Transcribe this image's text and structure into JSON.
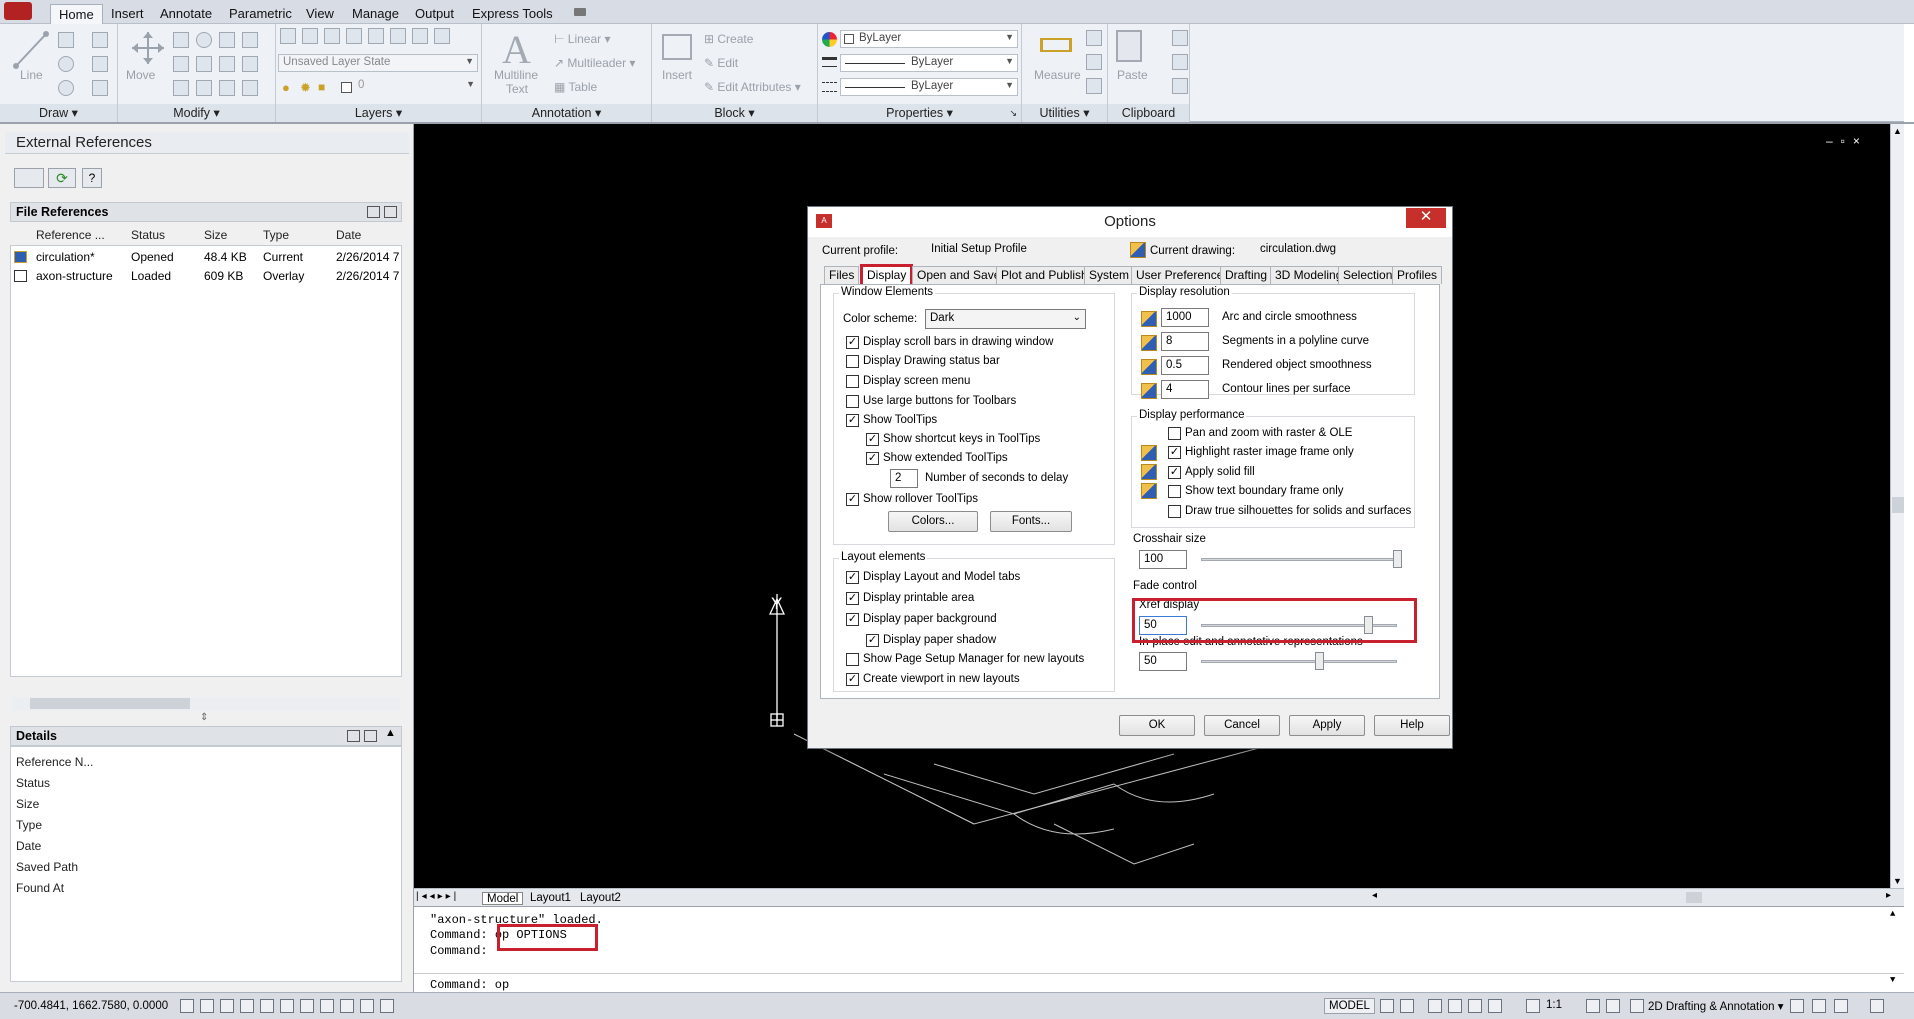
{
  "ribbon": {
    "tabs": [
      "Home",
      "Insert",
      "Annotate",
      "Parametric",
      "View",
      "Manage",
      "Output",
      "Express Tools"
    ],
    "active_tab": "Home",
    "panels": [
      "Draw",
      "Modify",
      "Layers",
      "Annotation",
      "Block",
      "Properties",
      "Utilities",
      "Clipboard"
    ],
    "tool_labels": {
      "line": "Line",
      "move": "Move",
      "multiline_text_1": "Multiline",
      "multiline_text_2": "Text",
      "insert": "Insert",
      "measure": "Measure",
      "paste": "Paste"
    },
    "annotation_items": {
      "linear": "Linear",
      "multileader": "Multileader",
      "table": "Table"
    },
    "block_items": {
      "create": "Create",
      "edit": "Edit",
      "edit_attributes": "Edit Attributes"
    },
    "layer_state": "Unsaved Layer State",
    "layer_value": "0",
    "properties": {
      "color": "ByLayer",
      "lineweight": "ByLayer",
      "linetype": "ByLayer"
    }
  },
  "xref_palette": {
    "title": "External References",
    "file_references_label": "File References",
    "columns": [
      "Reference ...",
      "Status",
      "Size",
      "Type",
      "Date"
    ],
    "rows": [
      {
        "name": "circulation*",
        "status": "Opened",
        "size": "48.4 KB",
        "type": "Current",
        "date": "2/26/2014 7:"
      },
      {
        "name": "axon-structure",
        "status": "Loaded",
        "size": "609 KB",
        "type": "Overlay",
        "date": "2/26/2014 7:"
      }
    ],
    "details_label": "Details",
    "details": [
      "Reference N...",
      "Status",
      "Size",
      "Type",
      "Date",
      "Saved Path",
      "Found At"
    ]
  },
  "drawing": {
    "ucs_y": "Y"
  },
  "layout_tabs": [
    "Model",
    "Layout1",
    "Layout2"
  ],
  "command_history": [
    "\"axon-structure\" loaded.",
    "Command: op OPTIONS",
    "Command:"
  ],
  "command_prefix": "Command:",
  "command_typed": "op OPTIONS",
  "command_input": "Command: op",
  "status_bar": {
    "coords": "-700.4841, 1662.7580, 0.0000",
    "model": "MODEL",
    "scale": "1:1",
    "workspace": "2D Drafting & Annotation"
  },
  "options_dialog": {
    "title": "Options",
    "current_profile_label": "Current profile:",
    "current_profile": "Initial Setup Profile",
    "current_drawing_label": "Current drawing:",
    "current_drawing": "circulation.dwg",
    "tabs": [
      "Files",
      "Display",
      "Open and Save",
      "Plot and Publish",
      "System",
      "User Preferences",
      "Drafting",
      "3D Modeling",
      "Selection",
      "Profiles"
    ],
    "active_tab": "Display",
    "window_elements": {
      "title": "Window Elements",
      "color_scheme_label": "Color scheme:",
      "color_scheme": "Dark",
      "checks": [
        {
          "label": "Display scroll bars in drawing window",
          "checked": true
        },
        {
          "label": "Display Drawing status bar",
          "checked": false
        },
        {
          "label": "Display screen menu",
          "checked": false
        },
        {
          "label": "Use large buttons for Toolbars",
          "checked": false
        },
        {
          "label": "Show ToolTips",
          "checked": true
        },
        {
          "label": "Show shortcut keys in ToolTips",
          "checked": true
        },
        {
          "label": "Show extended ToolTips",
          "checked": true
        }
      ],
      "delay_value": "2",
      "delay_label": "Number of seconds to delay",
      "rollover": {
        "label": "Show rollover ToolTips",
        "checked": true
      },
      "colors_button": "Colors...",
      "fonts_button": "Fonts..."
    },
    "layout_elements": {
      "title": "Layout elements",
      "checks": [
        {
          "label": "Display Layout and Model tabs",
          "checked": true
        },
        {
          "label": "Display printable area",
          "checked": true
        },
        {
          "label": "Display paper background",
          "checked": true
        },
        {
          "label": "Display paper shadow",
          "checked": true
        },
        {
          "label": "Show Page Setup Manager for new layouts",
          "checked": false
        },
        {
          "label": "Create viewport in new layouts",
          "checked": true
        }
      ]
    },
    "display_resolution": {
      "title": "Display resolution",
      "items": [
        {
          "value": "1000",
          "label": "Arc and circle smoothness"
        },
        {
          "value": "8",
          "label": "Segments in a polyline curve"
        },
        {
          "value": "0.5",
          "label": "Rendered object smoothness"
        },
        {
          "value": "4",
          "label": "Contour lines per surface"
        }
      ]
    },
    "display_performance": {
      "title": "Display performance",
      "checks": [
        {
          "label": "Pan and zoom with raster & OLE",
          "checked": false
        },
        {
          "label": "Highlight raster image frame only",
          "checked": true
        },
        {
          "label": "Apply solid fill",
          "checked": true
        },
        {
          "label": "Show text boundary frame only",
          "checked": false
        },
        {
          "label": "Draw true silhouettes for solids and surfaces",
          "checked": false
        }
      ]
    },
    "crosshair": {
      "title": "Crosshair size",
      "value": "100",
      "level": 1.0
    },
    "fade_control": {
      "title": "Fade control",
      "xref_label": "Xref display",
      "xref_value": "50",
      "xref_level": 0.85,
      "inplace_label": "In-place edit and annotative representations",
      "inplace_value": "50",
      "inplace_level": 0.6
    },
    "buttons": {
      "ok": "OK",
      "cancel": "Cancel",
      "apply": "Apply",
      "help": "Help"
    }
  }
}
